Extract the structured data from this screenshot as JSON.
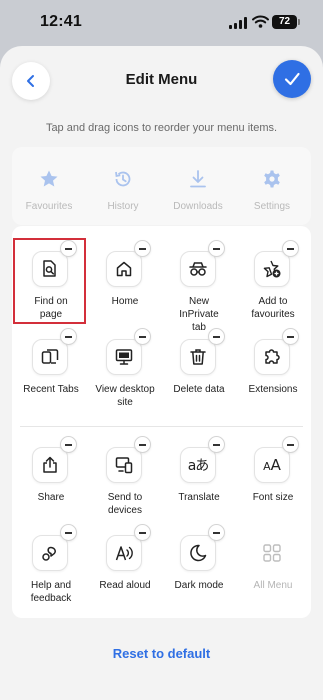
{
  "status": {
    "time": "12:41",
    "battery": "72"
  },
  "header": {
    "title": "Edit Menu",
    "subtitle": "Tap and drag icons to reorder your menu items."
  },
  "top_items": [
    {
      "label": "Favourites",
      "icon": "star-icon"
    },
    {
      "label": "History",
      "icon": "history-icon"
    },
    {
      "label": "Downloads",
      "icon": "download-icon"
    },
    {
      "label": "Settings",
      "icon": "gear-icon"
    }
  ],
  "items": [
    {
      "label": "Find on page",
      "icon": "find-on-page-icon"
    },
    {
      "label": "Home",
      "icon": "home-icon"
    },
    {
      "label": "New InPrivate tab",
      "icon": "inprivate-icon"
    },
    {
      "label": "Add to favourites",
      "icon": "add-favourite-icon"
    },
    {
      "label": "Recent Tabs",
      "icon": "recent-tabs-icon"
    },
    {
      "label": "View desktop site",
      "icon": "desktop-icon"
    },
    {
      "label": "Delete data",
      "icon": "trash-icon"
    },
    {
      "label": "Extensions",
      "icon": "puzzle-icon"
    },
    {
      "label": "Share",
      "icon": "share-icon"
    },
    {
      "label": "Send to devices",
      "icon": "send-to-devices-icon"
    },
    {
      "label": "Translate",
      "icon": "translate-icon"
    },
    {
      "label": "Font size",
      "icon": "font-size-icon"
    },
    {
      "label": "Help and feedback",
      "icon": "help-feedback-icon"
    },
    {
      "label": "Read aloud",
      "icon": "read-aloud-icon"
    },
    {
      "label": "Dark mode",
      "icon": "dark-mode-icon"
    },
    {
      "label": "All Menu",
      "icon": "all-menu-icon"
    }
  ],
  "footer": {
    "reset_label": "Reset to default"
  },
  "colors": {
    "accent": "#2f6fe4",
    "highlight": "#d32f3a",
    "disabled_icon": "#aac3ee"
  }
}
